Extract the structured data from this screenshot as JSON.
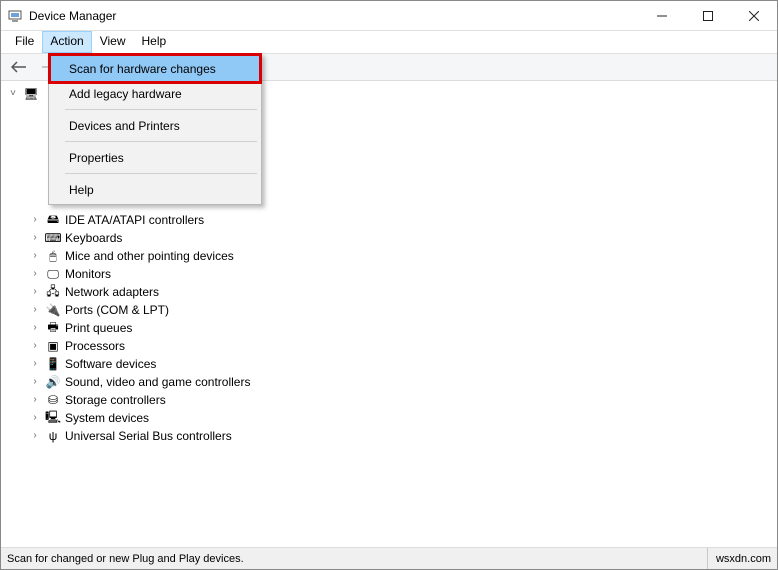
{
  "window": {
    "title": "Device Manager"
  },
  "menubar": {
    "items": [
      "File",
      "Action",
      "View",
      "Help"
    ],
    "open_index": 1
  },
  "dropdown": {
    "items": [
      {
        "label": "Scan for hardware changes",
        "highlighted": true
      },
      {
        "label": "Add legacy hardware"
      },
      {
        "sep": true
      },
      {
        "label": "Devices and Printers"
      },
      {
        "sep": true
      },
      {
        "label": "Properties"
      },
      {
        "sep": true
      },
      {
        "label": "Help"
      }
    ]
  },
  "tree": {
    "root_expanded": true,
    "root_icon": "computer",
    "children": [
      {
        "label": "",
        "icon": "hidden",
        "obscured": true
      },
      {
        "label": "",
        "icon": "hidden",
        "obscured": true
      },
      {
        "label": "",
        "icon": "hidden",
        "obscured": true
      },
      {
        "label": "",
        "icon": "hidden",
        "obscured": true
      },
      {
        "label": "",
        "icon": "hidden",
        "obscured": true
      },
      {
        "label": "",
        "icon": "hidden",
        "obscured": true
      },
      {
        "label": "IDE ATA/ATAPI controllers",
        "icon": "ide"
      },
      {
        "label": "Keyboards",
        "icon": "keyboard"
      },
      {
        "label": "Mice and other pointing devices",
        "icon": "mouse"
      },
      {
        "label": "Monitors",
        "icon": "monitor"
      },
      {
        "label": "Network adapters",
        "icon": "network"
      },
      {
        "label": "Ports (COM & LPT)",
        "icon": "port"
      },
      {
        "label": "Print queues",
        "icon": "printer"
      },
      {
        "label": "Processors",
        "icon": "cpu"
      },
      {
        "label": "Software devices",
        "icon": "software"
      },
      {
        "label": "Sound, video and game controllers",
        "icon": "sound"
      },
      {
        "label": "Storage controllers",
        "icon": "storage"
      },
      {
        "label": "System devices",
        "icon": "system"
      },
      {
        "label": "Universal Serial Bus controllers",
        "icon": "usb"
      }
    ]
  },
  "statusbar": {
    "left": "Scan for changed or new Plug and Play devices.",
    "right": "wsxdn.com"
  },
  "icons": {
    "computer": "🖥",
    "ide": "🖴",
    "keyboard": "⌨",
    "mouse": "🖱",
    "monitor": "🖵",
    "network": "🖧",
    "port": "🔌",
    "printer": "🖶",
    "cpu": "▣",
    "software": "📱",
    "sound": "🔊",
    "storage": "⛁",
    "system": "🖳",
    "usb": "ψ",
    "hidden": " "
  }
}
